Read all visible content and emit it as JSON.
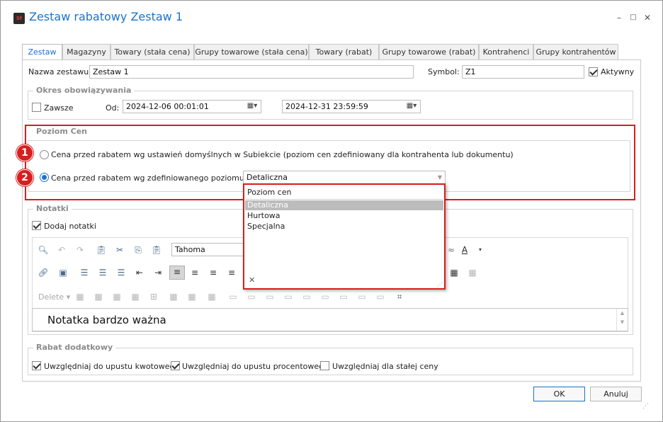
{
  "window": {
    "title": "Zestaw rabatowy Zestaw 1",
    "app_icon": "Sf"
  },
  "tabs": [
    {
      "label": "Zestaw"
    },
    {
      "label": "Magazyny"
    },
    {
      "label": "Towary (stała cena)"
    },
    {
      "label": "Grupy towarowe (stała cena)"
    },
    {
      "label": "Towary (rabat)"
    },
    {
      "label": "Grupy towarowe (rabat)"
    },
    {
      "label": "Kontrahenci"
    },
    {
      "label": "Grupy kontrahentów"
    }
  ],
  "header": {
    "name_label": "Nazwa zestawu:",
    "name_value": "Zestaw 1",
    "symbol_label": "Symbol:",
    "symbol_value": "Z1",
    "active_label": "Aktywny",
    "active_checked": true
  },
  "period": {
    "title": "Okres obowiązywania",
    "always_label": "Zawsze",
    "from_label": "Od:",
    "from_value": "2024-12-06 00:01:01",
    "to_value": "2024-12-31 23:59:59"
  },
  "price_level": {
    "title": "Poziom Cen",
    "option1": "Cena przed rabatem wg ustawień domyślnych w Subiekcie (poziom cen zdefiniowany dla kontrahenta lub dokumentu)",
    "option2": "Cena przed rabatem wg zdefiniowanego poziomu cen",
    "selected_option": 2,
    "select_value": "Detaliczna",
    "badge1": "1",
    "badge2": "2"
  },
  "dropdown": {
    "header": "Poziom cen",
    "items": [
      "Detaliczna",
      "Hurtowa",
      "Specjalna"
    ],
    "selected": "Detaliczna",
    "clear_glyph": "✕"
  },
  "notes": {
    "title": "Notatki",
    "add_label": "Dodaj notatki",
    "add_checked": true,
    "font_value": "Tahoma",
    "delete_label": "Delete",
    "content": "Notatka bardzo ważna"
  },
  "discount": {
    "title": "Rabat dodatkowy",
    "opt1": "Uwzględniaj do upustu kwotowego",
    "opt2": "Uwzględniaj do upustu procentowego",
    "opt3": "Uwzględniaj dla stałej ceny",
    "opt1_checked": true,
    "opt2_checked": true,
    "opt3_checked": false
  },
  "footer": {
    "ok_label": "OK",
    "cancel_label": "Anuluj"
  },
  "colors": {
    "accent": "#1a73c9",
    "highlight_red": "#d81e1e"
  }
}
